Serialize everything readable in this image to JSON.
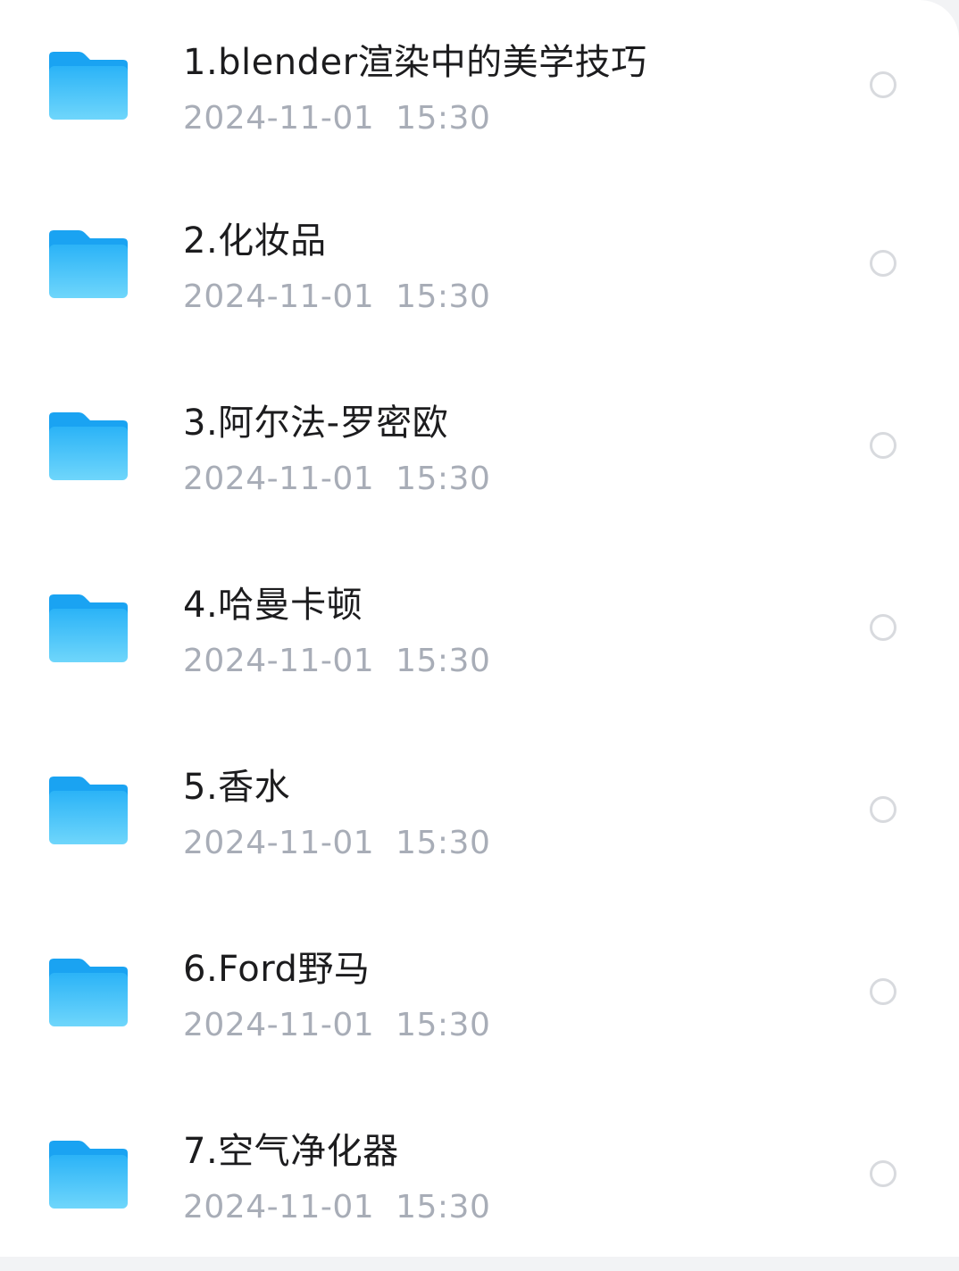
{
  "colors": {
    "folder_top": "#1aa3f2",
    "folder_front_top": "#2bb3f7",
    "folder_front_bottom": "#6fd6fb",
    "title_text": "#1c1c1e",
    "date_text": "#a8adb7",
    "radio_border": "#d8dade"
  },
  "files": [
    {
      "icon": "folder-icon",
      "name": "1.blender渲染中的美学技巧",
      "date": "2024-11-01  15:30",
      "selected": false
    },
    {
      "icon": "folder-icon",
      "name": "2.化妆品",
      "date": "2024-11-01  15:30",
      "selected": false
    },
    {
      "icon": "folder-icon",
      "name": "3.阿尔法-罗密欧",
      "date": "2024-11-01  15:30",
      "selected": false
    },
    {
      "icon": "folder-icon",
      "name": "4.哈曼卡顿",
      "date": "2024-11-01  15:30",
      "selected": false
    },
    {
      "icon": "folder-icon",
      "name": "5.香水",
      "date": "2024-11-01  15:30",
      "selected": false
    },
    {
      "icon": "folder-icon",
      "name": "6.Ford野马",
      "date": "2024-11-01  15:30",
      "selected": false
    },
    {
      "icon": "folder-icon",
      "name": "7.空气净化器",
      "date": "2024-11-01  15:30",
      "selected": false
    }
  ]
}
